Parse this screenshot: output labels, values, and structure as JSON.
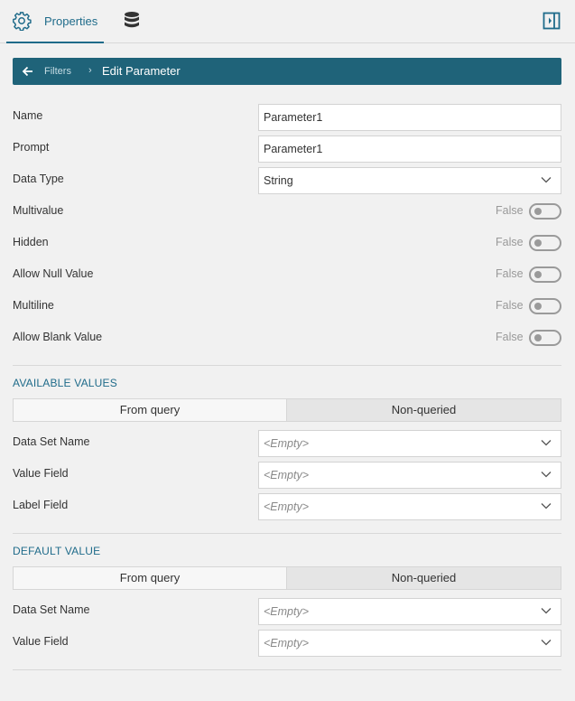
{
  "header": {
    "properties_tab": "Properties",
    "icons": [
      "gear-icon",
      "database-icon",
      "panel-toggle-icon"
    ]
  },
  "breadcrumb": {
    "parent": "Filters",
    "separator": "›",
    "current": "Edit Parameter"
  },
  "fields": {
    "name": {
      "label": "Name",
      "value": "Parameter1"
    },
    "prompt": {
      "label": "Prompt",
      "value": "Parameter1"
    },
    "data_type": {
      "label": "Data Type",
      "value": "String"
    }
  },
  "toggles": [
    {
      "label": "Multivalue",
      "state": "False"
    },
    {
      "label": "Hidden",
      "state": "False"
    },
    {
      "label": "Allow Null Value",
      "state": "False"
    },
    {
      "label": "Multiline",
      "state": "False"
    },
    {
      "label": "Allow Blank Value",
      "state": "False"
    }
  ],
  "available_values": {
    "title": "AVAILABLE VALUES",
    "tabs": [
      "From query",
      "Non-queried"
    ],
    "fields": [
      {
        "label": "Data Set Name",
        "value": "<Empty>"
      },
      {
        "label": "Value Field",
        "value": "<Empty>"
      },
      {
        "label": "Label Field",
        "value": "<Empty>"
      }
    ]
  },
  "default_value": {
    "title": "DEFAULT VALUE",
    "tabs": [
      "From query",
      "Non-queried"
    ],
    "fields": [
      {
        "label": "Data Set Name",
        "value": "<Empty>"
      },
      {
        "label": "Value Field",
        "value": "<Empty>"
      }
    ]
  },
  "colors": {
    "accent": "#1f6b8a",
    "breadcrumb_bg": "#1f6379",
    "background": "#f1f1f1"
  }
}
